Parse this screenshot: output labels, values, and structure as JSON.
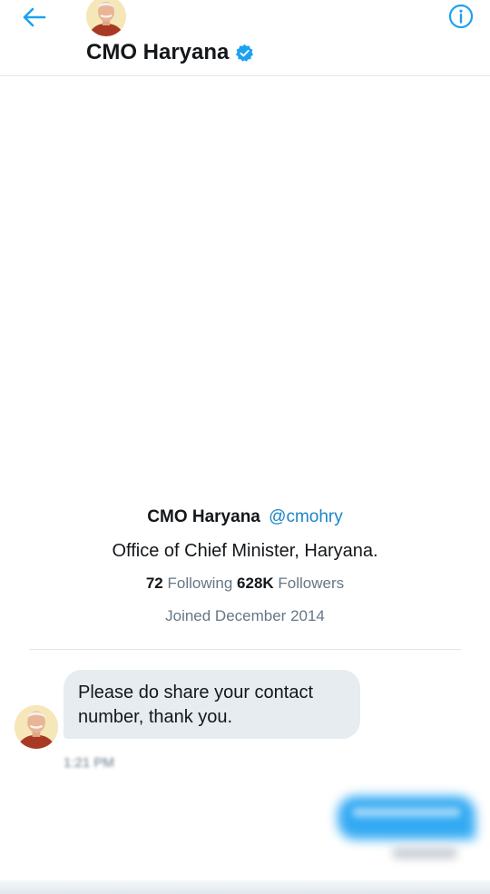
{
  "header": {
    "title": "CMO Haryana",
    "back_icon": "arrow-left-icon",
    "info_icon": "info-circle-icon",
    "verified_icon": "verified-badge-icon"
  },
  "profile": {
    "name": "CMO Haryana",
    "handle": "@cmohry",
    "bio": "Office of Chief Minister, Haryana.",
    "following_count": "72",
    "following_label": "Following",
    "followers_count": "628K",
    "followers_label": "Followers",
    "joined": "Joined December 2014"
  },
  "messages": [
    {
      "text": "Please do share your contact number, thank you.",
      "time": "1:21 PM",
      "direction": "incoming"
    }
  ],
  "colors": {
    "accent": "#1da1f2",
    "handle": "#1b86c7",
    "incoming_bubble": "#e6ecf0",
    "muted_text": "#657786",
    "primary_text": "#14171a",
    "divider": "#e1e8ed"
  }
}
